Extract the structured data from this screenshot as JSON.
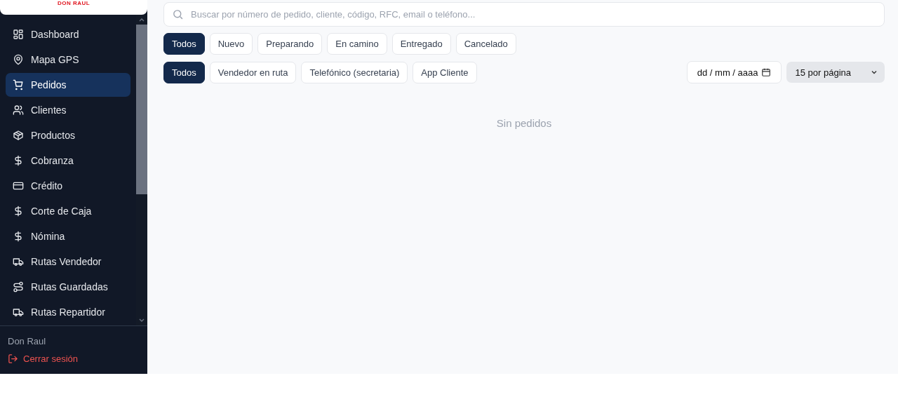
{
  "brand": {
    "logo_text": "DON RAUL"
  },
  "sidebar": {
    "items": [
      {
        "label": "Dashboard",
        "kind": "grid",
        "selected": false
      },
      {
        "label": "Mapa GPS",
        "kind": "pin",
        "selected": false
      },
      {
        "label": "Pedidos",
        "kind": "cart",
        "selected": true
      },
      {
        "label": "Clientes",
        "kind": "users",
        "selected": false
      },
      {
        "label": "Productos",
        "kind": "box",
        "selected": false
      },
      {
        "label": "Cobranza",
        "kind": "dollar",
        "selected": false
      },
      {
        "label": "Crédito",
        "kind": "card",
        "selected": false
      },
      {
        "label": "Corte de Caja",
        "kind": "dollar",
        "selected": false
      },
      {
        "label": "Nómina",
        "kind": "dollar",
        "selected": false
      },
      {
        "label": "Rutas Vendedor",
        "kind": "truck",
        "selected": false
      },
      {
        "label": "Rutas Guardadas",
        "kind": "route",
        "selected": false
      },
      {
        "label": "Rutas Repartidor",
        "kind": "truck",
        "selected": false
      }
    ],
    "user_name": "Don Raul",
    "logout": "Cerrar sesión"
  },
  "search": {
    "placeholder": "Buscar por número de pedido, cliente, código, RFC, email o teléfono..."
  },
  "status_filters": [
    {
      "label": "Todos",
      "selected": true
    },
    {
      "label": "Nuevo",
      "selected": false
    },
    {
      "label": "Preparando",
      "selected": false
    },
    {
      "label": "En camino",
      "selected": false
    },
    {
      "label": "Entregado",
      "selected": false
    },
    {
      "label": "Cancelado",
      "selected": false
    }
  ],
  "source_filters": [
    {
      "label": "Todos",
      "selected": true
    },
    {
      "label": "Vendedor en ruta",
      "selected": false
    },
    {
      "label": "Telefónico (secretaria)",
      "selected": false
    },
    {
      "label": "App Cliente",
      "selected": false
    }
  ],
  "date_field": {
    "placeholder": "dd / mm / aaaa"
  },
  "page_size": {
    "value": "15 por página"
  },
  "empty_message": "Sin pedidos"
}
